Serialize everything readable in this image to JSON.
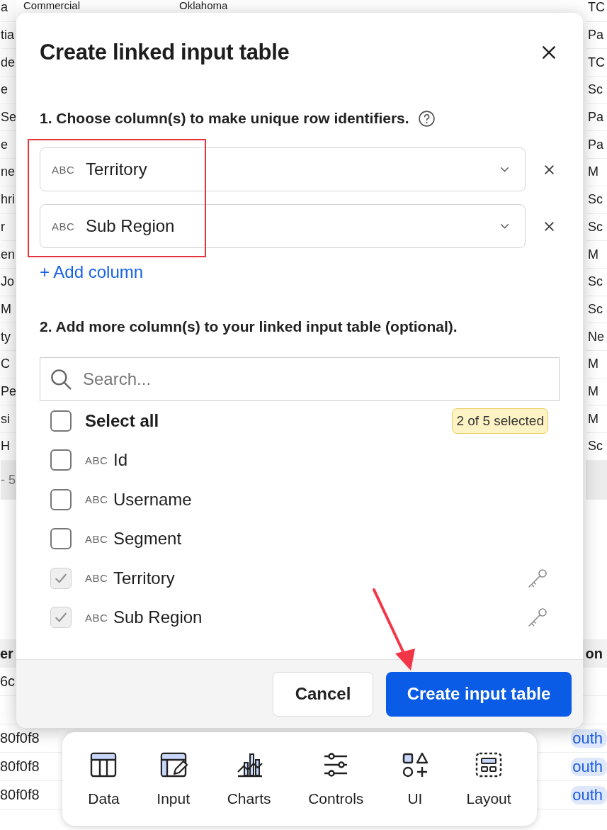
{
  "background": {
    "top_row": [
      "Commercial",
      "Oklahoma"
    ],
    "left_cells": [
      "a",
      "tia",
      "de",
      "e",
      "Se",
      "e",
      "ne",
      "hri",
      "r",
      "en",
      "Jo",
      "M",
      "ty",
      "C",
      "Pe",
      "si",
      "H"
    ],
    "left_footer": "- 5",
    "right_cells": [
      "TC",
      "Pa",
      "TC",
      "Sc",
      "Pa",
      "Pa",
      "M",
      "Sc",
      "Sc",
      "M",
      "Sc",
      "Sc",
      "Ne",
      "M",
      "M",
      "M",
      "Sc"
    ],
    "lower_header": [
      "er",
      "on"
    ],
    "lower_left": [
      "6c",
      "80f0f8",
      "80f0f8",
      "80f0f8"
    ],
    "lower_right": [
      "outh",
      "outh",
      "outh"
    ]
  },
  "dialog": {
    "title": "Create linked input table",
    "section_1": "1. Choose column(s) to make unique row identifiers.",
    "identifier_columns": [
      {
        "type_tag": "ABC",
        "name": "Territory"
      },
      {
        "type_tag": "ABC",
        "name": "Sub Region"
      }
    ],
    "add_column": "+ Add column",
    "section_2": "2. Add more column(s) to your linked input table (optional).",
    "search": {
      "placeholder": "Search..."
    },
    "select_all": {
      "label": "Select all",
      "checked": false
    },
    "selection_count": "2 of 5 selected",
    "columns": [
      {
        "type_tag": "ABC",
        "name": "Id",
        "checked": false,
        "disabled": false,
        "key": false
      },
      {
        "type_tag": "ABC",
        "name": "Username",
        "checked": false,
        "disabled": false,
        "key": false
      },
      {
        "type_tag": "ABC",
        "name": "Segment",
        "checked": false,
        "disabled": false,
        "key": false
      },
      {
        "type_tag": "ABC",
        "name": "Territory",
        "checked": true,
        "disabled": true,
        "key": true
      },
      {
        "type_tag": "ABC",
        "name": "Sub Region",
        "checked": true,
        "disabled": true,
        "key": true
      }
    ],
    "buttons": [
      {
        "label": "Cancel",
        "kind": "secondary"
      },
      {
        "label": "Create input table",
        "kind": "primary"
      }
    ]
  },
  "toolbar": [
    {
      "label": "Data",
      "kind": "data"
    },
    {
      "label": "Input",
      "kind": "input"
    },
    {
      "label": "Charts",
      "kind": "charts"
    },
    {
      "label": "Controls",
      "kind": "controls"
    },
    {
      "label": "UI",
      "kind": "ui"
    },
    {
      "label": "Layout",
      "kind": "layout"
    }
  ]
}
